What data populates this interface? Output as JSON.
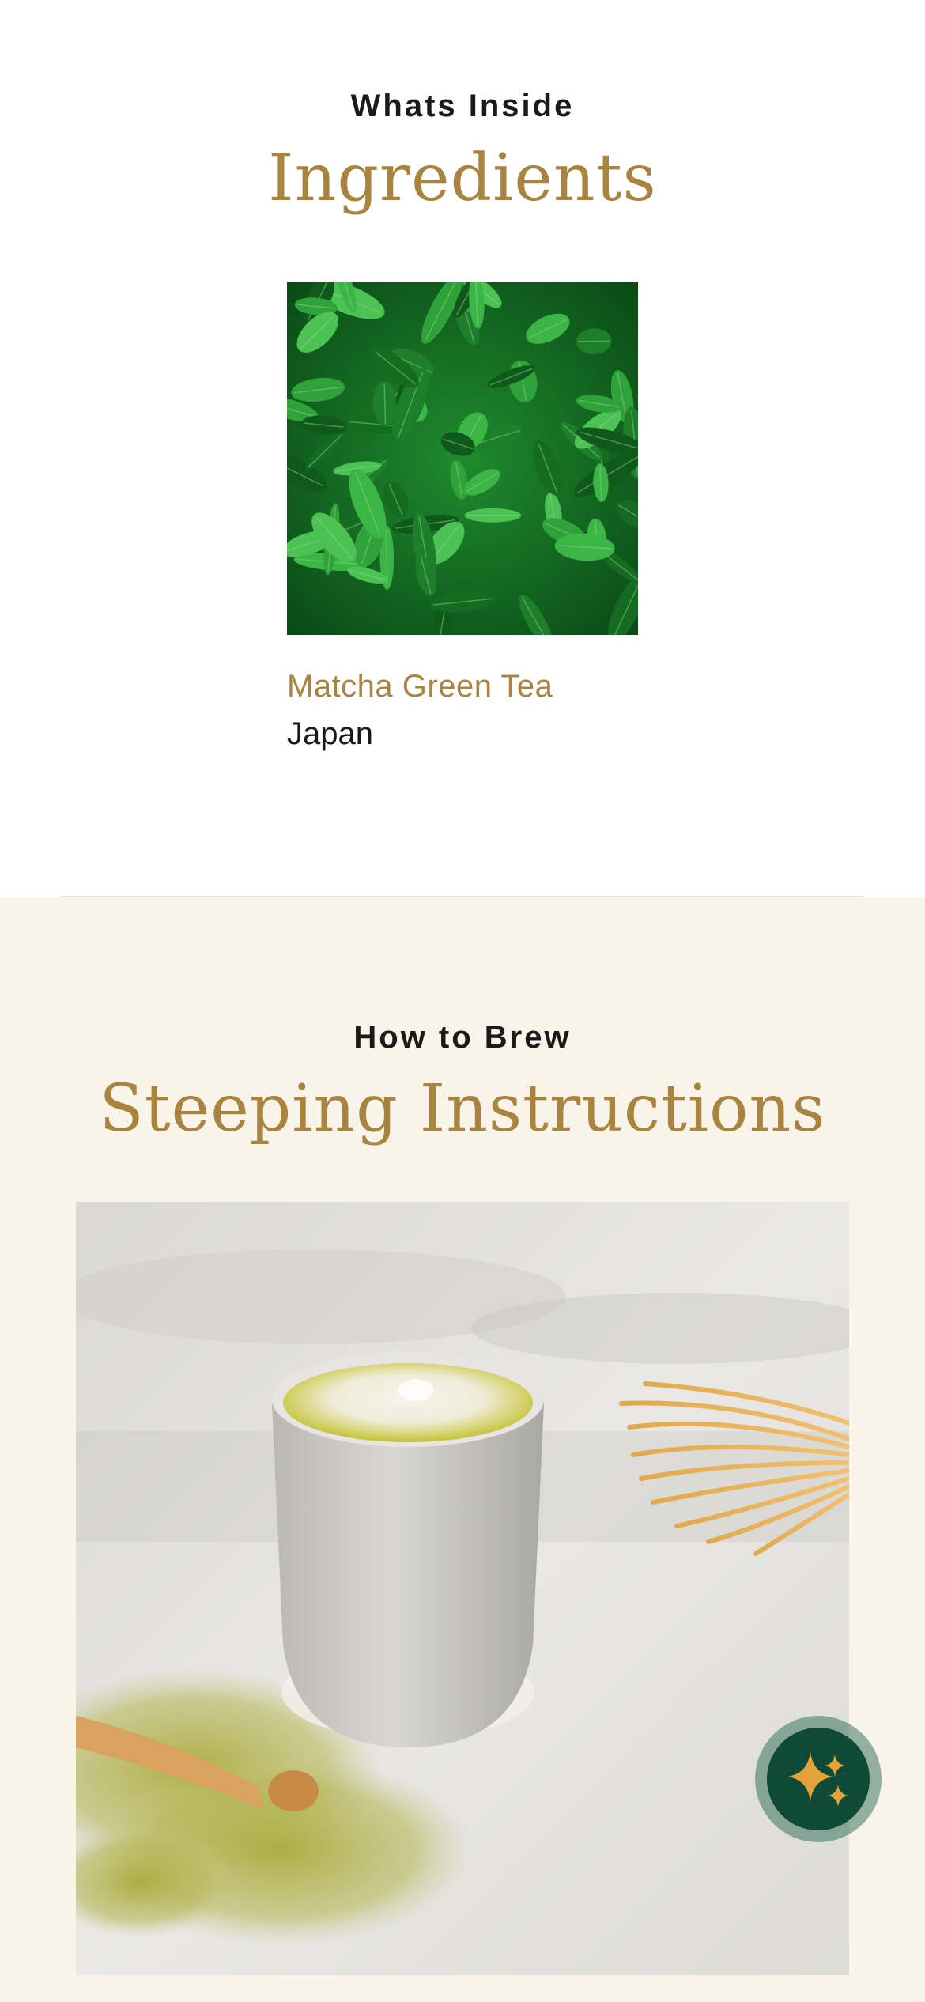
{
  "ingredients_section": {
    "eyebrow": "Whats Inside",
    "title": "Ingredients",
    "items": [
      {
        "name": "Matcha Green Tea",
        "origin": "Japan"
      }
    ]
  },
  "brew_section": {
    "eyebrow": "How to Brew",
    "title": "Steeping Instructions"
  },
  "assistant_fab": {
    "icon": "sparkles-icon"
  },
  "colors": {
    "accent_gold": "#a8843f",
    "text_dark": "#1a1a1a",
    "cream_background": "#faf3e9",
    "fab_green": "#0f4a36",
    "sparkle_gold": "#e3a33a"
  }
}
